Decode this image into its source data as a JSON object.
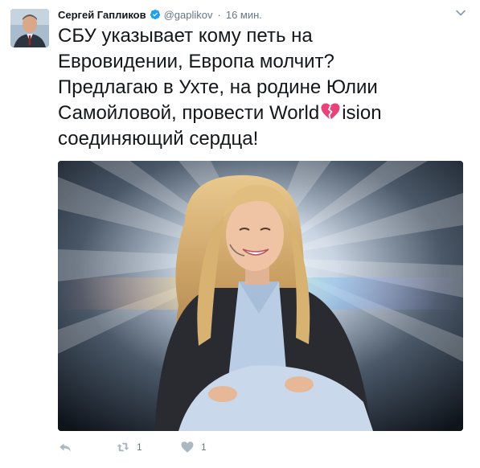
{
  "tweet": {
    "author_name": "Сергей Гапликов",
    "handle": "@gaplikov",
    "separator": "·",
    "time": "16 мин.",
    "text_lines": [
      "СБУ указывает кому петь на",
      "Евровидении, Европа молчит?",
      "Предлагаю в Ухте, на родине Юлии",
      "Самойловой, провести World"
    ],
    "text_after_emoji": "ision",
    "text_last_line": "соединяющий сердца!",
    "emoji_icon": "broken-heart-icon",
    "colors": {
      "verified": "#1da1f2",
      "emoji": "#e8447a",
      "muted": "#657786",
      "icon": "#aab8c2"
    }
  },
  "actions": {
    "reply_icon": "reply-icon",
    "retweet_icon": "retweet-icon",
    "retweet_count": "1",
    "like_icon": "like-heart-icon",
    "like_count": "1"
  }
}
